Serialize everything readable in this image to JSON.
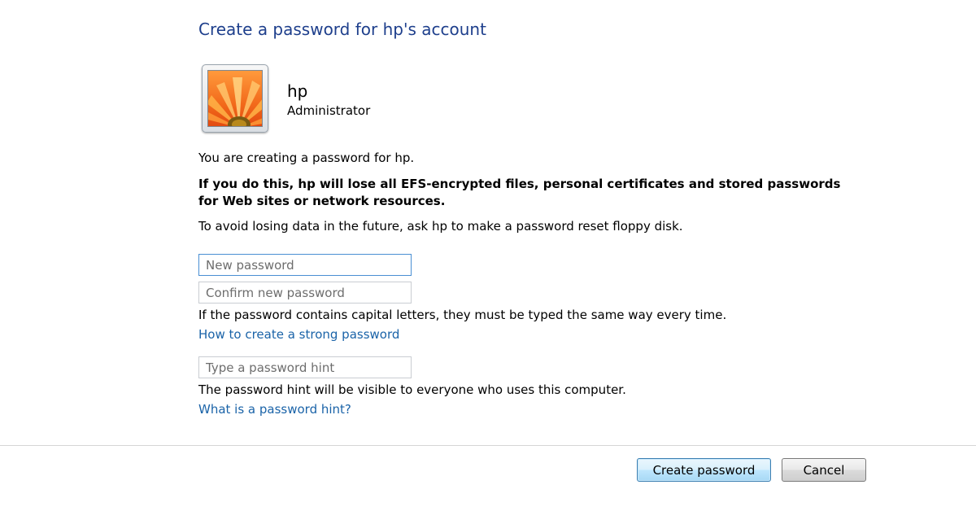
{
  "header": {
    "title": "Create a password for hp's account"
  },
  "user": {
    "name": "hp",
    "role": "Administrator",
    "avatar_icon": "flower-avatar-icon"
  },
  "messages": {
    "creating_for": "You are creating a password for hp.",
    "warning": "If you do this, hp will lose all EFS-encrypted files, personal certificates and stored passwords for Web sites or network resources.",
    "advice": "To avoid losing data in the future, ask hp to make a password reset floppy disk.",
    "capital_note": "If the password contains capital letters, they must be typed the same way every time.",
    "hint_note": "The password hint will be visible to everyone who uses this computer."
  },
  "fields": {
    "new_password": {
      "value": "",
      "placeholder": "New password"
    },
    "confirm_password": {
      "value": "",
      "placeholder": "Confirm new password"
    },
    "hint": {
      "value": "",
      "placeholder": "Type a password hint"
    }
  },
  "links": {
    "strong_password": "How to create a strong password",
    "password_hint": "What is a password hint?"
  },
  "buttons": {
    "create": "Create password",
    "cancel": "Cancel"
  },
  "colors": {
    "title": "#1e3f8c",
    "link": "#1a63a8",
    "primary_button_border": "#3c7fb1"
  }
}
